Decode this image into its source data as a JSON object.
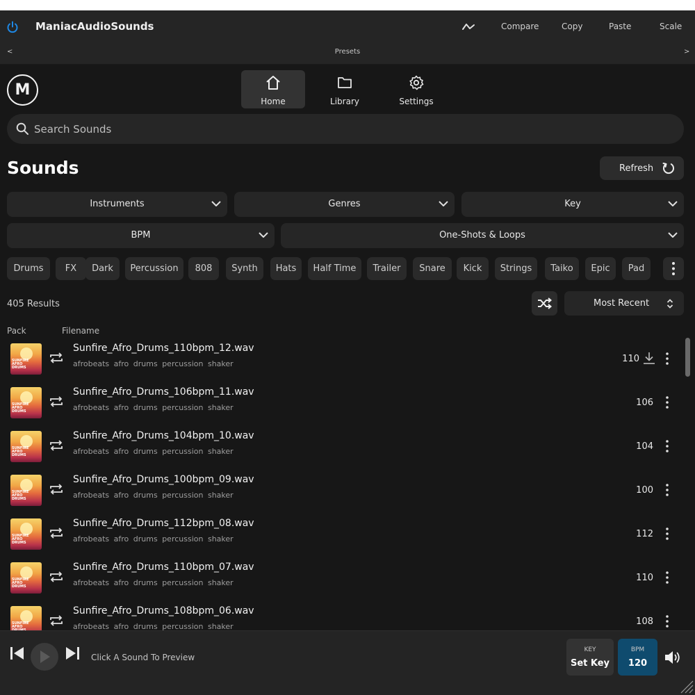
{
  "host": {
    "title": "ManiacAudioSounds",
    "buttons": [
      "Compare",
      "Copy",
      "Paste",
      "Scale"
    ],
    "presets_label": "Presets",
    "prev_arrow": "<",
    "next_arrow": ">"
  },
  "logo": {
    "letter": "M"
  },
  "nav": {
    "home": "Home",
    "library": "Library",
    "settings": "Settings",
    "active": "Home"
  },
  "search": {
    "placeholder": "Search Sounds",
    "value": ""
  },
  "page": {
    "title": "Sounds",
    "refresh_label": "Refresh"
  },
  "filters": {
    "instruments": "Instruments",
    "genres": "Genres",
    "key": "Key",
    "bpm": "BPM",
    "type": "One-Shots & Loops"
  },
  "tags": [
    "Drums",
    "FX",
    "Dark",
    "Percussion",
    "808",
    "Synth",
    "Hats",
    "Half Time",
    "Trailer",
    "Snare",
    "Kick",
    "Strings",
    "Taiko",
    "Epic",
    "Pad"
  ],
  "results": {
    "count_label": "405 Results",
    "sort": "Most Recent",
    "col_pack": "Pack",
    "col_filename": "Filename"
  },
  "sounds": [
    {
      "filename": "Sunfire_Afro_Drums_110bpm_12.wav",
      "tags": "afrobeats afro drums percussion shaker",
      "bpm": "110"
    },
    {
      "filename": "Sunfire_Afro_Drums_106bpm_11.wav",
      "tags": "afrobeats afro drums percussion shaker",
      "bpm": "106"
    },
    {
      "filename": "Sunfire_Afro_Drums_104bpm_10.wav",
      "tags": "afrobeats afro drums percussion shaker",
      "bpm": "104"
    },
    {
      "filename": "Sunfire_Afro_Drums_100bpm_09.wav",
      "tags": "afrobeats afro drums percussion shaker",
      "bpm": "100"
    },
    {
      "filename": "Sunfire_Afro_Drums_112bpm_08.wav",
      "tags": "afrobeats afro drums percussion shaker",
      "bpm": "112"
    },
    {
      "filename": "Sunfire_Afro_Drums_110bpm_07.wav",
      "tags": "afrobeats afro drums percussion shaker",
      "bpm": "110"
    },
    {
      "filename": "Sunfire_Afro_Drums_108bpm_06.wav",
      "tags": "afrobeats afro drums percussion shaker",
      "bpm": "108"
    }
  ],
  "pack_art": {
    "text_line1": "SUNFIRE",
    "text_line2": "AFRO",
    "text_line3": "DRUMS"
  },
  "player": {
    "preview_text": "Click A Sound To Preview",
    "key_caption": "KEY",
    "key_value": "Set Key",
    "bpm_caption": "BPM",
    "bpm_value": "120"
  },
  "colors": {
    "background": "#171717",
    "host_bar": "#252525",
    "accent_blue": "#1e88e5",
    "bpm_box": "#0f4b6e"
  },
  "icons": [
    "power-icon",
    "graph-icon",
    "home-icon",
    "folder-icon",
    "gear-icon",
    "search-icon",
    "refresh-icon",
    "chevron-down-icon",
    "more-vertical-icon",
    "shuffle-icon",
    "sort-icon",
    "loop-icon",
    "download-icon",
    "skip-previous-icon",
    "play-icon",
    "skip-next-icon",
    "volume-icon"
  ]
}
